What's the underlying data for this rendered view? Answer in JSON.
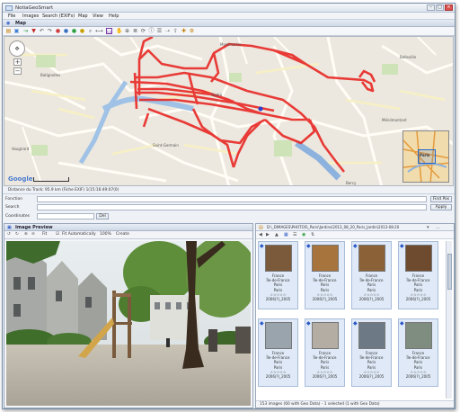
{
  "window": {
    "title": "NotiaGeoSmart"
  },
  "menu": [
    "File",
    "Images",
    "Search (EXIFs)",
    "Map",
    "View",
    "Help"
  ],
  "map_panel": {
    "title": "Map",
    "labels": [
      "Batignolles",
      "Montmartre",
      "Belleville",
      "Bercy",
      "Vaugirard",
      "Saint-Germain",
      "Opéra",
      "Ménilmontant",
      "Paris"
    ],
    "track_color": "#e8231f",
    "status": "Distance du Track: 95.9 km (Fiche EXIF) 1(15:16:49:07(0)"
  },
  "fields": {
    "keyword_label": "Fonction",
    "search_label": "Search",
    "coords_label": "Coordinates",
    "find_btn": "Find Pos",
    "apply_btn": "Apply",
    "clear_btn": "Del"
  },
  "left_panel": {
    "title": "Image Preview",
    "toolbar": [
      "Fit",
      "Fit Automatically",
      "100%",
      "Create"
    ]
  },
  "right_panel": {
    "path": "D:\\_DIMAGES\\PHOTOS\\_Paris\\Jardins\\2013_08_20_Paris_Jardin\\2013-08-20",
    "status": "153 images (60 with Geo Data) - 1 selected (1 with Geo Data)",
    "thumbs": [
      {
        "name": "2006(?)_2005",
        "country": "France",
        "region": "Île-de-France",
        "city": "Paris",
        "sub": "Paris",
        "color": "#7a5a3a"
      },
      {
        "name": "2006(?)_2005",
        "country": "France",
        "region": "Île-de-France",
        "city": "Paris",
        "sub": "Paris",
        "color": "#a8743e"
      },
      {
        "name": "2006(?)_2005",
        "country": "France",
        "region": "Île-de-France",
        "city": "Paris",
        "sub": "Paris",
        "color": "#8b6238"
      },
      {
        "name": "2006(?)_2005",
        "country": "France",
        "region": "Île-de-France",
        "city": "Paris",
        "sub": "Paris",
        "color": "#6e4b2e"
      },
      {
        "name": "2006(?)_2005",
        "country": "France",
        "region": "Île-de-France",
        "city": "Paris",
        "sub": "Paris",
        "color": "#9aa4ad"
      },
      {
        "name": "2006(?)_2005",
        "country": "France",
        "region": "Île-de-France",
        "city": "Paris",
        "sub": "Paris",
        "color": "#b3ada3"
      },
      {
        "name": "2006(?)_2005",
        "country": "France",
        "region": "Île-de-France",
        "city": "Paris",
        "sub": "Paris",
        "color": "#6d7a86"
      },
      {
        "name": "2006(?)_2005",
        "country": "France",
        "region": "Île-de-France",
        "city": "Paris",
        "sub": "Paris",
        "color": "#7f8c80"
      }
    ]
  }
}
